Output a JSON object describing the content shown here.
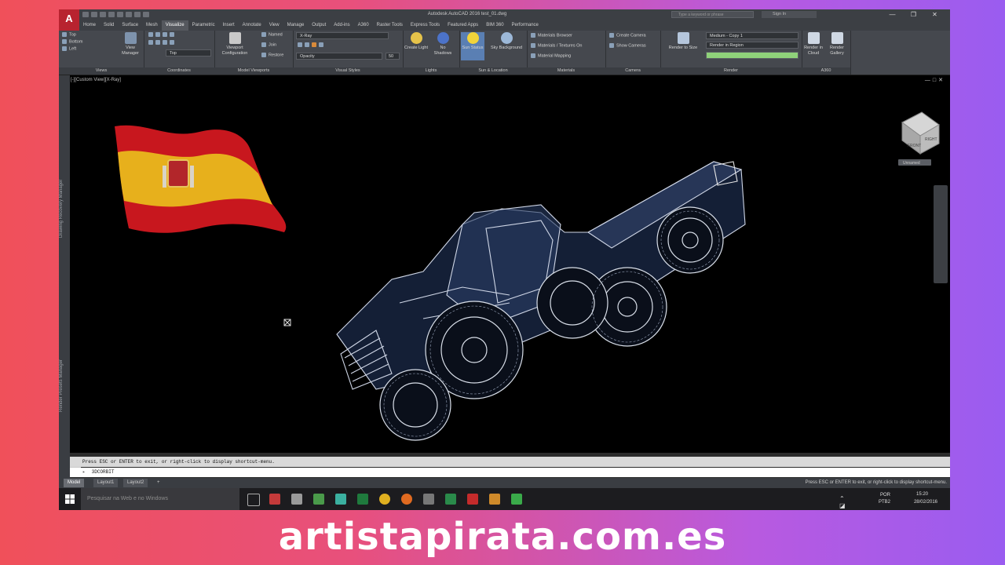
{
  "app": {
    "logo": "A",
    "title": "Autodesk AutoCAD 2016  test_01.dwg",
    "search_placeholder": "Type a keyword or phrase",
    "sign_in": "Sign In"
  },
  "tabs": [
    "Home",
    "Solid",
    "Surface",
    "Mesh",
    "Visualize",
    "Parametric",
    "Insert",
    "Annotate",
    "View",
    "Manage",
    "Output",
    "Add-ins",
    "A360",
    "Raster Tools",
    "Express Tools",
    "Featured Apps",
    "BIM 360",
    "Performance"
  ],
  "active_tab": "Visualize",
  "ribbon": {
    "views": {
      "label": "Views",
      "items": [
        "Top",
        "Bottom",
        "Left"
      ],
      "manager": "View Manager"
    },
    "coordinates": {
      "label": "Coordinates",
      "dropdown": "Top"
    },
    "model_viewports": {
      "label": "Model Viewports",
      "big": "Viewport Configuration",
      "items": [
        "Named",
        "Join",
        "Restore"
      ]
    },
    "visual_styles": {
      "label": "Visual Styles",
      "dropdown": "X-Ray",
      "input_label": "Opacity",
      "input_value": "50"
    },
    "lights": {
      "label": "Lights",
      "create": "Create Light",
      "shadows": "No Shadows"
    },
    "sun": {
      "label": "Sun & Location",
      "status": "Sun Status",
      "sky": "Sky Background"
    },
    "materials": {
      "label": "Materials",
      "items": [
        "Materials Browser",
        "Materials / Textures On",
        "Material Mapping"
      ]
    },
    "camera": {
      "label": "Camera",
      "items": [
        "Create Camera",
        "Show Cameras"
      ]
    },
    "render": {
      "label": "Render",
      "to_size": "Render to Size",
      "preset": "Medium - Copy 1",
      "region": "Render in Region"
    },
    "a360": {
      "label": "A360",
      "cloud": "Render in Cloud",
      "gallery": "Render Gallery"
    }
  },
  "viewport": {
    "label": "[-][Custom View][X-Ray]",
    "left_labels": [
      "Drawing Recovery Manager",
      "Render Presets Manager"
    ],
    "viewcube_faces": [
      "RIGHT",
      "FRONT"
    ],
    "viewcube_menu": "Unnamed"
  },
  "command": {
    "history": "Press ESC or ENTER to exit, or right-click to display shortcut-menu.",
    "input": "3DCORBIT"
  },
  "status": {
    "layout_tabs": [
      "Model",
      "Layout1",
      "Layout2"
    ],
    "message": "Press ESC or ENTER to exit, or right-click to display shortcut-menu."
  },
  "taskbar": {
    "search": "Pesquisar na Web e no Windows",
    "lang": "POR",
    "lang2": "PTB2",
    "time": "15:20",
    "date": "28/02/2016"
  },
  "brand": "artistapirata.com.es",
  "colors": {
    "accent": "#b8232f",
    "background_left": "#f0505a",
    "background_right": "#9a5cf0"
  }
}
